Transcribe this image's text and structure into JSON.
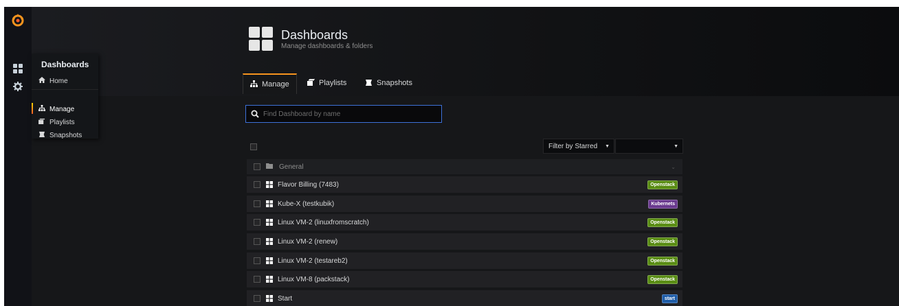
{
  "sidemenu": {
    "logo": "grafana-logo-icon",
    "icons": [
      "dashboards-icon",
      "gear-icon"
    ]
  },
  "flyout": {
    "title": "Dashboards",
    "items": [
      {
        "label": "Home",
        "icon": "home-icon"
      },
      {
        "label": "Manage",
        "icon": "sitemap-icon",
        "active": true
      },
      {
        "label": "Playlists",
        "icon": "playlist-icon"
      },
      {
        "label": "Snapshots",
        "icon": "snapshot-icon"
      }
    ]
  },
  "header": {
    "title": "Dashboards",
    "subtitle": "Manage dashboards & folders",
    "tabs": [
      {
        "label": "Manage",
        "active": true
      },
      {
        "label": "Playlists"
      },
      {
        "label": "Snapshots"
      }
    ]
  },
  "search": {
    "placeholder": "Find Dashboard by name",
    "value": ""
  },
  "filters": {
    "starred_label": "Filter by Starred",
    "tag_value": ""
  },
  "folder": {
    "name": "General"
  },
  "dashboards": [
    {
      "title": "Flavor Billing (7483)",
      "tag": "Openstack",
      "tag_color": "#5a8d14"
    },
    {
      "title": "Kube-X (testkubik)",
      "tag": "Kubernets",
      "tag_color": "#6a3a8f"
    },
    {
      "title": "Linux VM-2 (linuxfromscratch)",
      "tag": "Openstack",
      "tag_color": "#5a8d14"
    },
    {
      "title": "Linux VM-2 (renew)",
      "tag": "Openstack",
      "tag_color": "#5a8d14"
    },
    {
      "title": "Linux VM-2 (testareb2)",
      "tag": "Openstack",
      "tag_color": "#5a8d14"
    },
    {
      "title": "Linux VM-8 (packstack)",
      "tag": "Openstack",
      "tag_color": "#5a8d14"
    },
    {
      "title": "Start",
      "tag": "start",
      "tag_color": "#1f5da8"
    }
  ],
  "colors": {
    "accent": "#f7941e",
    "focus": "#3d71d9",
    "background": "#161719"
  }
}
